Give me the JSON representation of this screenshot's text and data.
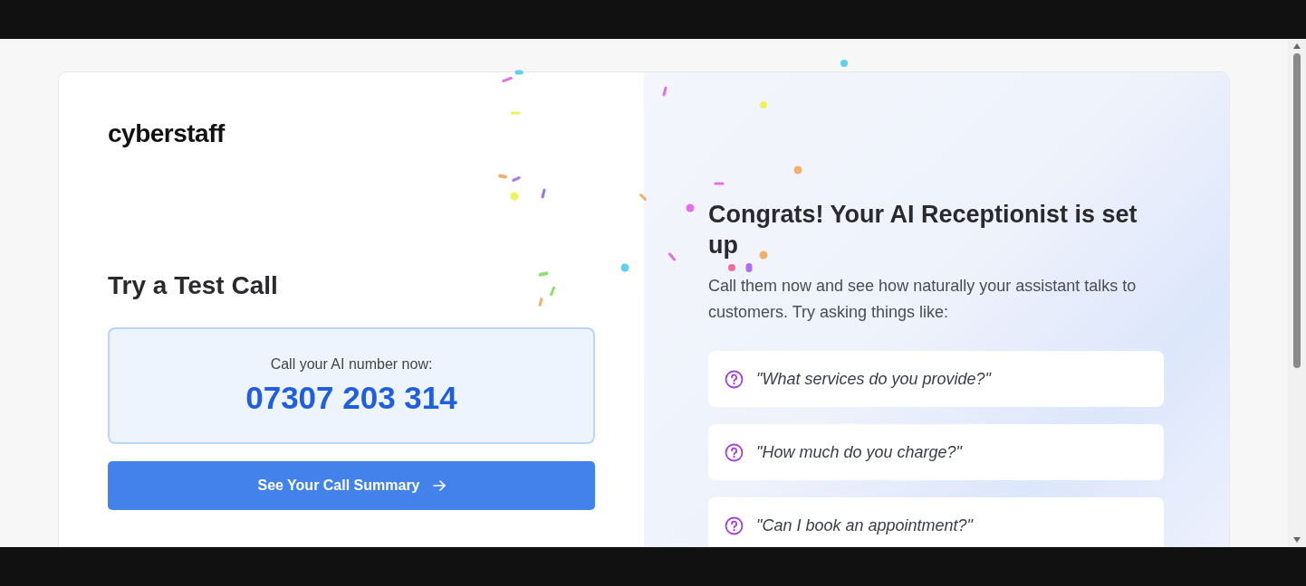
{
  "brand": {
    "logo": "cyberstaff"
  },
  "test_call": {
    "title": "Try a Test Call",
    "number_label": "Call your AI number now:",
    "number": "07307 203 314",
    "button": "See Your Call Summary"
  },
  "congrats": {
    "title": "Congrats! Your AI Receptionist is set up",
    "text": "Call them now and see how naturally your assistant talks to customers. Try asking things like:",
    "questions": [
      {
        "text": "\"What services do you provide?\""
      },
      {
        "text": "\"How much do you charge?\""
      },
      {
        "text": "\"Can I book an appointment?\""
      }
    ]
  }
}
